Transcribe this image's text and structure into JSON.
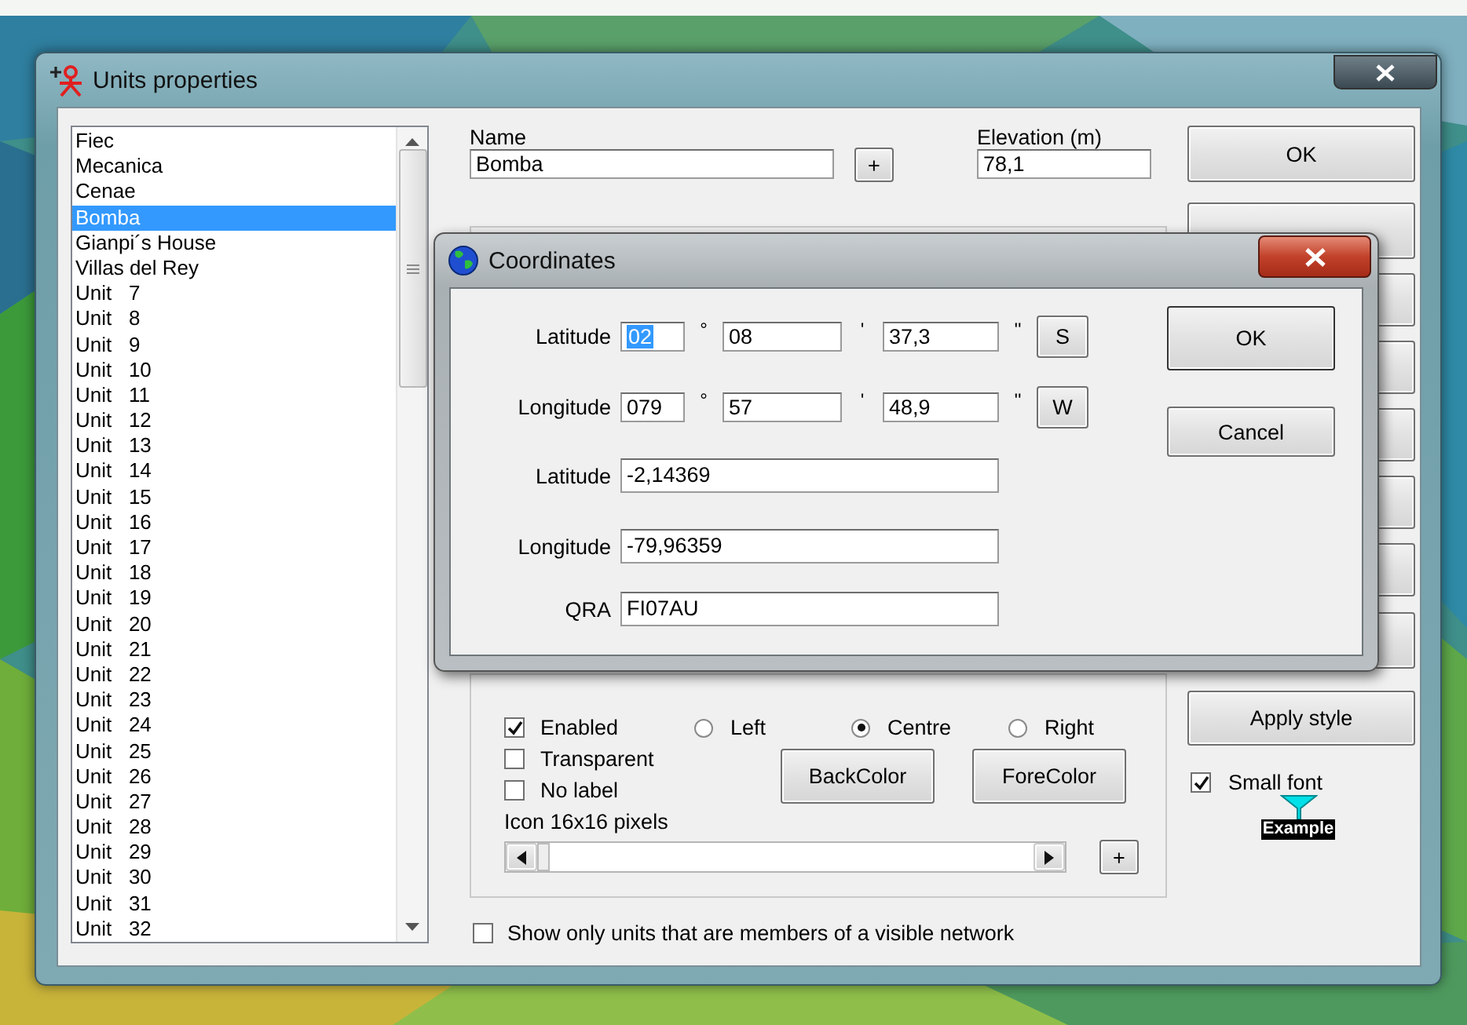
{
  "window": {
    "title": "Units properties"
  },
  "units": [
    {
      "label": "Fiec",
      "selected": false
    },
    {
      "label": "Mecanica",
      "selected": false
    },
    {
      "label": "Cenae",
      "selected": false
    },
    {
      "label": "Bomba",
      "selected": true
    },
    {
      "label": "Gianpi´s House",
      "selected": false
    },
    {
      "label": "Villas del Rey",
      "selected": false
    },
    {
      "label": "Unit   7",
      "selected": false
    },
    {
      "label": "Unit   8",
      "selected": false
    },
    {
      "label": "Unit   9",
      "selected": false
    },
    {
      "label": "Unit   10",
      "selected": false
    },
    {
      "label": "Unit   11",
      "selected": false
    },
    {
      "label": "Unit   12",
      "selected": false
    },
    {
      "label": "Unit   13",
      "selected": false
    },
    {
      "label": "Unit   14",
      "selected": false
    },
    {
      "label": "Unit   15",
      "selected": false
    },
    {
      "label": "Unit   16",
      "selected": false
    },
    {
      "label": "Unit   17",
      "selected": false
    },
    {
      "label": "Unit   18",
      "selected": false
    },
    {
      "label": "Unit   19",
      "selected": false
    },
    {
      "label": "Unit   20",
      "selected": false
    },
    {
      "label": "Unit   21",
      "selected": false
    },
    {
      "label": "Unit   22",
      "selected": false
    },
    {
      "label": "Unit   23",
      "selected": false
    },
    {
      "label": "Unit   24",
      "selected": false
    },
    {
      "label": "Unit   25",
      "selected": false
    },
    {
      "label": "Unit   26",
      "selected": false
    },
    {
      "label": "Unit   27",
      "selected": false
    },
    {
      "label": "Unit   28",
      "selected": false
    },
    {
      "label": "Unit   29",
      "selected": false
    },
    {
      "label": "Unit   30",
      "selected": false
    },
    {
      "label": "Unit   31",
      "selected": false
    },
    {
      "label": "Unit   32",
      "selected": false
    }
  ],
  "name_field": {
    "label": "Name",
    "value": "Bomba",
    "add_button": "+"
  },
  "elevation_field": {
    "label": "Elevation (m)",
    "value": "78,1"
  },
  "style_group": {
    "options": [
      {
        "label": "Enabled",
        "checked": true
      },
      {
        "label": "Transparent",
        "checked": false
      },
      {
        "label": "No label",
        "checked": false
      }
    ],
    "alignment": [
      {
        "label": "Left",
        "selected": false
      },
      {
        "label": "Centre",
        "selected": true
      },
      {
        "label": "Right",
        "selected": false
      }
    ],
    "color_buttons": [
      "BackColor",
      "ForeColor"
    ],
    "icon_size_label": "Icon 16x16 pixels",
    "icon_size_add_button": "+"
  },
  "show_only_visible_network": {
    "label": "Show only units that are members of a visible network",
    "checked": false
  },
  "side_buttons": [
    {
      "label": "OK"
    },
    {
      "label": "Apply style"
    }
  ],
  "small_font": {
    "label": "Small font",
    "checked": true
  },
  "example_label": "Example",
  "dialog": {
    "title": "Coordinates",
    "dms_rows": [
      {
        "label": "Latitude",
        "degrees": "02",
        "degrees_highlighted": true,
        "minutes": "08",
        "seconds": "37,3",
        "hemisphere": "S"
      },
      {
        "label": "Longitude",
        "degrees": "079",
        "degrees_highlighted": false,
        "minutes": "57",
        "seconds": "48,9",
        "hemisphere": "W"
      }
    ],
    "marks": [
      "°",
      "'",
      "''"
    ],
    "decimal_rows": [
      {
        "label": "Latitude",
        "value": "-2,14369"
      },
      {
        "label": "Longitude",
        "value": "-79,96359"
      },
      {
        "label": "QRA",
        "value": "FI07AU"
      }
    ],
    "buttons": [
      "OK",
      "Cancel"
    ]
  }
}
